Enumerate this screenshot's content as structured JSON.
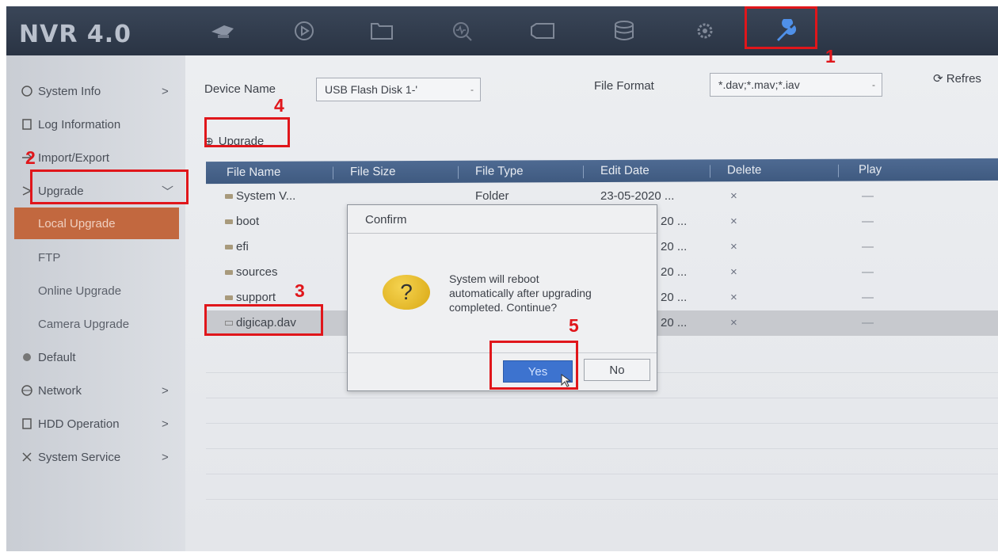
{
  "app": {
    "logo": "NVR 4.0"
  },
  "topbar": {
    "icons": [
      "camera-icon",
      "playback-icon",
      "file-icon",
      "search-icon",
      "tag-icon",
      "storage-icon",
      "configuration-icon",
      "maintenance-icon"
    ]
  },
  "sidebar": {
    "items": [
      {
        "label": "System Info",
        "arrow": ">"
      },
      {
        "label": "Log Information",
        "arrow": ""
      },
      {
        "label": "Import/Export",
        "arrow": ""
      },
      {
        "label": "Upgrade",
        "arrow": "﹀"
      },
      {
        "label": "Local Upgrade",
        "arrow": ""
      },
      {
        "label": "FTP",
        "arrow": ""
      },
      {
        "label": "Online Upgrade",
        "arrow": ""
      },
      {
        "label": "Camera Upgrade",
        "arrow": ""
      },
      {
        "label": "Default",
        "arrow": ""
      },
      {
        "label": "Network",
        "arrow": ">"
      },
      {
        "label": "HDD Operation",
        "arrow": ">"
      },
      {
        "label": "System Service",
        "arrow": ">"
      }
    ]
  },
  "main": {
    "device_name_label": "Device Name",
    "device_name_value": "USB Flash Disk 1-'",
    "device_name_arrow": "-",
    "file_format_label": "File Format",
    "file_format_value": "*.dav;*.mav;*.iav",
    "file_format_arrow": "-",
    "refresh_label": "Refres",
    "upgrade_label": "Upgrade",
    "upgrade_icon": "⊕"
  },
  "table": {
    "headers": [
      "File Name",
      "File Size",
      "File Type",
      "Edit Date",
      "Delete",
      "Play"
    ],
    "rows": [
      {
        "name": "System V...",
        "size": "",
        "type": "Folder",
        "date": "23-05-2020 ...",
        "delete": "×",
        "play": "—"
      },
      {
        "name": "boot",
        "size": "",
        "type": "",
        "date": "20 ...",
        "delete": "×",
        "play": "—"
      },
      {
        "name": "efi",
        "size": "",
        "type": "",
        "date": "20 ...",
        "delete": "×",
        "play": "—"
      },
      {
        "name": "sources",
        "size": "",
        "type": "",
        "date": "20 ...",
        "delete": "×",
        "play": "—"
      },
      {
        "name": "support",
        "size": "",
        "type": "",
        "date": "20 ...",
        "delete": "×",
        "play": "—"
      },
      {
        "name": "digicap.dav",
        "size": "",
        "type": "",
        "date": "20 ...",
        "delete": "×",
        "play": "—"
      }
    ]
  },
  "dialog": {
    "title": "Confirm",
    "icon": "?",
    "message_line1": "System will reboot",
    "message_line2": "automatically after upgrading",
    "message_line3": "completed. Continue?",
    "yes_label": "Yes",
    "no_label": "No"
  },
  "annotations": {
    "n1": "1",
    "n2": "2",
    "n3": "3",
    "n4": "4",
    "n5": "5",
    "color": "#e0161b"
  },
  "colors": {
    "topbar": "#2a3444",
    "selected_sidebar": "#c2683f",
    "table_header": "#4e6a92",
    "yes_button": "#3d73cf"
  }
}
